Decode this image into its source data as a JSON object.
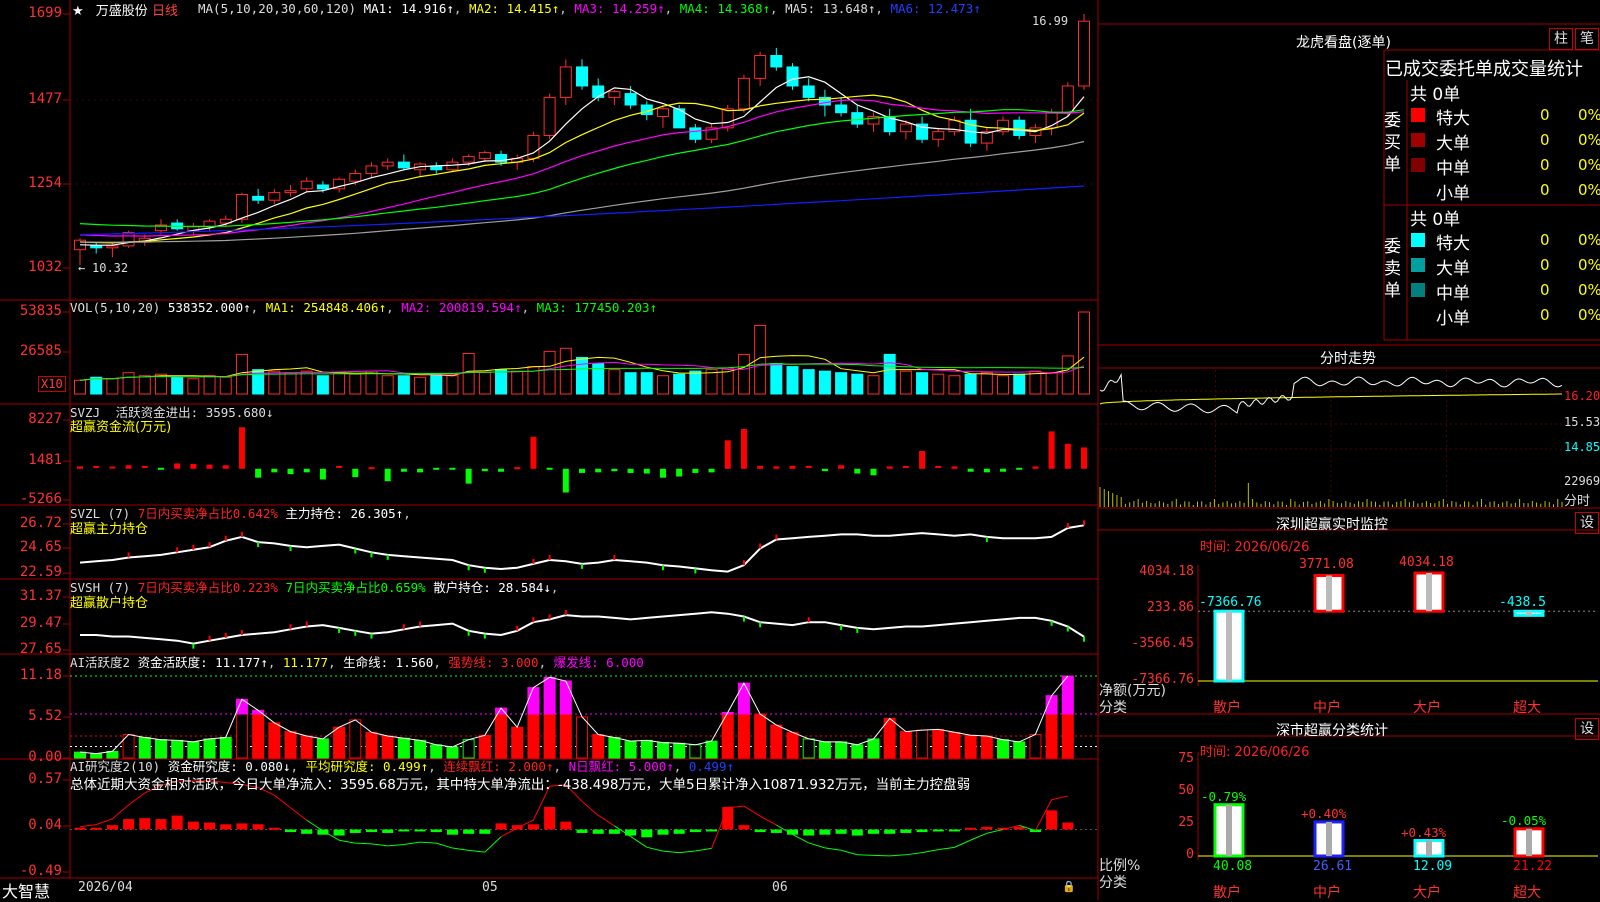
{
  "app": {
    "name": "大智慧",
    "stock": "万盛股份",
    "period": "日线"
  },
  "colors": {
    "up": "#ff2a2a",
    "down": "#00ffff",
    "ma1": "#ffffff",
    "ma2": "#ffff00",
    "ma3": "#ff00ff",
    "ma4": "#00ff00",
    "ma5": "#a0a0a0",
    "ma6": "#1020ff",
    "grid": "#a00000",
    "magenta": "#ff00ff",
    "green": "#00ff00",
    "red": "#ff0000",
    "cyan": "#00ffff",
    "yellow": "#ffff00"
  },
  "header_main": {
    "ma_label": "MA(5,10,20,30,60,120)",
    "ma1": "MA1: 14.916↑",
    "ma2": "MA2: 14.415↑",
    "ma3": "MA3: 14.259↑",
    "ma4": "MA4: 14.368↑",
    "ma5": "MA5: 13.648↑",
    "ma6": "MA6: 12.473↑",
    "high_mark": "16.99",
    "low_mark": "10.32"
  },
  "header_vol": {
    "label": "VOL(5,10,20)",
    "value": "538352.000↑",
    "ma1": "MA1: 254848.406↑",
    "ma2": "MA2: 200819.594↑",
    "ma3": "MA3: 177450.203↑",
    "unit": "X10"
  },
  "header_svzj": {
    "code": "SVZJ",
    "text": "活跃资金进出: 3595.680↓",
    "line2": "超赢资金流(万元)"
  },
  "header_svzl": {
    "code": "SVZL (7)",
    "ratio": "7日内买卖净占比0.642%",
    "hold": "主力持仓: 26.305↑",
    "line2": "超赢主力持仓"
  },
  "header_svsh": {
    "code": "SVSH (7)",
    "ratio1": "7日内买卖净占比0.223%",
    "ratio2": "7日内买卖净占比0.659%",
    "hold": "散户持仓: 28.584↓",
    "line2": "超赢散户持仓"
  },
  "header_ai": {
    "code": "AI活跃度2",
    "a": "资金活跃度: 11.177↑",
    "b": "11.177",
    "c": "生命线: 1.560",
    "d": "强势线: 3.000",
    "e": "爆发线: 6.000"
  },
  "header_ai2": {
    "code": "AI研究度2(10)",
    "a": "资金研究度: 0.080↓",
    "b": "平均研究度: 0.499↑",
    "c": "连续飘红: 2.000↑",
    "d": "N日飘红: 5.000↑",
    "e": "0.499↑",
    "summary": "总体近期大资金相对活跃，今日大单净流入：3595.68万元，其中特大单净流出：-438.498万元，大单5日累计净入10871.932万元，当前主力控盘弱"
  },
  "axes": {
    "main": [
      "1699",
      "1477",
      "1254",
      "1032"
    ],
    "vol": [
      "53835",
      "26585"
    ],
    "svzj": [
      "8227",
      "1481",
      "-5266"
    ],
    "svzl": [
      "26.72",
      "24.65",
      "22.59"
    ],
    "svsh": [
      "31.37",
      "29.47",
      "27.65"
    ],
    "ai": [
      "11.18",
      "5.52",
      "0.00"
    ],
    "ai2": [
      "0.57",
      "0.04",
      "-0.49"
    ]
  },
  "xaxis": {
    "d1": "2026/04",
    "d2": "05",
    "d3": "06"
  },
  "right": {
    "lhb_title": "龙虎看盘(逐单)",
    "btn_zhu": "柱",
    "btn_bi": "笔",
    "order_title": "已成交委托单成交量统计",
    "buy_label": "委买单",
    "sell_label": "委卖单",
    "buy_total": "共 0单",
    "sell_total": "共 0单",
    "rows": [
      {
        "name": "特大",
        "n": "0",
        "p": "0%"
      },
      {
        "name": "大单",
        "n": "0",
        "p": "0%"
      },
      {
        "name": "中单",
        "n": "0",
        "p": "0%"
      },
      {
        "name": "小单",
        "n": "0",
        "p": "0%"
      }
    ],
    "fenshi_title": "分时走势",
    "fenshi_axis": [
      "16.20",
      "15.53",
      "14.85",
      "22969",
      "分时"
    ],
    "monitor_title": "深圳超赢实时监控",
    "monitor_btn": "设",
    "monitor_time": "时间: 2026/06/26",
    "monitor_axis": [
      "4034.18",
      "233.86",
      "-3566.45",
      "-7366.76"
    ],
    "monitor_bars": [
      {
        "cat": "散户",
        "v": -7366.76,
        "label": "-7366.76"
      },
      {
        "cat": "中户",
        "v": 3771.08,
        "label": "3771.08"
      },
      {
        "cat": "大户",
        "v": 4034.18,
        "label": "4034.18"
      },
      {
        "cat": "超大",
        "v": -438.5,
        "label": "-438.5"
      }
    ],
    "monitor_ylab1": "净额(万元)",
    "monitor_ylab2": "分类",
    "class_title": "深市超赢分类统计",
    "class_btn": "设",
    "class_time": "时间: 2026/06/26",
    "class_axis": [
      "75",
      "50",
      "25",
      "0"
    ],
    "class_bars": [
      {
        "cat": "散户",
        "v": 40.08,
        "label": "40.08",
        "chg": "-0.79%"
      },
      {
        "cat": "中户",
        "v": 26.61,
        "label": "26.61",
        "chg": "+0.40%"
      },
      {
        "cat": "大户",
        "v": 12.09,
        "label": "12.09",
        "chg": "+0.43%"
      },
      {
        "cat": "超大",
        "v": 21.22,
        "label": "21.22",
        "chg": "-0.05%"
      }
    ],
    "class_ylab1": "比例%",
    "class_ylab2": "分类"
  },
  "chart_data": [
    {
      "type": "candlestick",
      "title": "万盛股份 日线",
      "ylim": [
        10.32,
        16.99
      ],
      "high": 16.99,
      "low": 10.32,
      "candles": [
        [
          10.8,
          11.1,
          10.4,
          11.05
        ],
        [
          10.9,
          11.0,
          10.7,
          10.85
        ],
        [
          10.85,
          11.0,
          10.6,
          10.9
        ],
        [
          10.9,
          11.3,
          10.85,
          11.25
        ],
        [
          11.0,
          11.2,
          10.9,
          11.1
        ],
        [
          11.3,
          11.6,
          11.2,
          11.45
        ],
        [
          11.5,
          11.6,
          11.3,
          11.35
        ],
        [
          11.3,
          11.5,
          11.2,
          11.4
        ],
        [
          11.4,
          11.6,
          11.3,
          11.55
        ],
        [
          11.5,
          11.7,
          11.4,
          11.6
        ],
        [
          11.6,
          12.3,
          11.5,
          12.25
        ],
        [
          12.2,
          12.4,
          12.0,
          12.1
        ],
        [
          12.1,
          12.4,
          12.0,
          12.3
        ],
        [
          12.3,
          12.5,
          12.2,
          12.35
        ],
        [
          12.4,
          12.7,
          12.3,
          12.6
        ],
        [
          12.5,
          12.6,
          12.3,
          12.4
        ],
        [
          12.4,
          12.7,
          12.3,
          12.65
        ],
        [
          12.6,
          12.9,
          12.5,
          12.8
        ],
        [
          12.8,
          13.1,
          12.7,
          13.0
        ],
        [
          13.0,
          13.2,
          12.9,
          13.1
        ],
        [
          13.1,
          13.3,
          12.9,
          12.95
        ],
        [
          12.9,
          13.1,
          12.7,
          13.05
        ],
        [
          13.0,
          13.1,
          12.8,
          12.9
        ],
        [
          12.9,
          13.2,
          12.85,
          13.1
        ],
        [
          13.1,
          13.3,
          13.0,
          13.25
        ],
        [
          13.2,
          13.4,
          13.1,
          13.35
        ],
        [
          13.3,
          13.4,
          13.0,
          13.1
        ],
        [
          13.1,
          13.3,
          12.9,
          13.2
        ],
        [
          13.2,
          13.9,
          13.1,
          13.8
        ],
        [
          13.8,
          14.9,
          13.7,
          14.8
        ],
        [
          14.8,
          15.8,
          14.6,
          15.6
        ],
        [
          15.6,
          15.8,
          15.0,
          15.1
        ],
        [
          15.1,
          15.3,
          14.7,
          14.8
        ],
        [
          14.8,
          15.0,
          14.6,
          14.95
        ],
        [
          14.9,
          15.1,
          14.5,
          14.6
        ],
        [
          14.6,
          14.7,
          14.2,
          14.35
        ],
        [
          14.3,
          14.6,
          14.0,
          14.5
        ],
        [
          14.5,
          14.6,
          14.0,
          14.0
        ],
        [
          14.0,
          14.1,
          13.6,
          13.7
        ],
        [
          13.7,
          14.1,
          13.6,
          14.0
        ],
        [
          14.0,
          14.6,
          13.9,
          14.5
        ],
        [
          14.5,
          15.4,
          14.4,
          15.3
        ],
        [
          15.3,
          16.0,
          15.1,
          15.9
        ],
        [
          15.9,
          16.1,
          15.5,
          15.6
        ],
        [
          15.6,
          15.7,
          15.0,
          15.1
        ],
        [
          15.1,
          15.3,
          14.7,
          14.8
        ],
        [
          14.8,
          15.0,
          14.3,
          14.6
        ],
        [
          14.6,
          14.8,
          14.3,
          14.4
        ],
        [
          14.4,
          14.6,
          14.0,
          14.1
        ],
        [
          14.1,
          14.4,
          13.9,
          14.3
        ],
        [
          14.3,
          14.5,
          13.8,
          13.9
        ],
        [
          13.9,
          14.2,
          13.7,
          14.1
        ],
        [
          14.1,
          14.3,
          13.6,
          13.7
        ],
        [
          13.7,
          14.0,
          13.5,
          13.9
        ],
        [
          13.9,
          14.3,
          13.8,
          14.2
        ],
        [
          14.2,
          14.5,
          13.5,
          13.6
        ],
        [
          13.6,
          14.0,
          13.4,
          13.9
        ],
        [
          13.9,
          14.3,
          13.8,
          14.2
        ],
        [
          14.2,
          14.3,
          13.7,
          13.8
        ],
        [
          13.8,
          14.1,
          13.6,
          14.0
        ],
        [
          14.0,
          14.5,
          13.8,
          14.4
        ],
        [
          14.4,
          15.2,
          14.3,
          15.1
        ],
        [
          15.1,
          16.99,
          15.0,
          16.8
        ]
      ],
      "ma_last": {
        "MA1": 14.916,
        "MA2": 14.415,
        "MA3": 14.259,
        "MA4": 14.368,
        "MA5": 13.648,
        "MA6": 12.473
      }
    },
    {
      "type": "bar",
      "title": "VOL(5,10,20)",
      "ylim": [
        0,
        53835
      ],
      "unit": "X10",
      "values": [
        9000,
        11000,
        10000,
        14000,
        12000,
        13000,
        11000,
        10000,
        12000,
        11000,
        26000,
        16000,
        15000,
        14000,
        15000,
        12000,
        14000,
        13000,
        15000,
        12000,
        12000,
        11000,
        13000,
        12000,
        26585,
        14000,
        16000,
        15000,
        18000,
        28000,
        30000,
        24000,
        20000,
        16000,
        14000,
        14000,
        12000,
        13000,
        15000,
        16000,
        17000,
        26000,
        45000,
        20000,
        18000,
        16000,
        15000,
        14000,
        13000,
        12000,
        26000,
        15000,
        14000,
        13000,
        12000,
        13000,
        14000,
        12000,
        13000,
        15000,
        14000,
        25000,
        53835
      ],
      "last": 538352.0
    },
    {
      "type": "bar",
      "title": "活跃资金进出 (万元)",
      "ylim": [
        -5266,
        8227
      ],
      "values": [
        400,
        300,
        200,
        600,
        300,
        -200,
        900,
        800,
        700,
        600,
        7000,
        -1500,
        -600,
        -900,
        -600,
        -1800,
        300,
        -1400,
        100,
        -2100,
        -500,
        -600,
        -300,
        -200,
        -2500,
        -400,
        -500,
        100,
        5400,
        -300,
        -4000,
        -700,
        -600,
        -400,
        -700,
        -800,
        -1500,
        -1300,
        -700,
        -600,
        4800,
        6700,
        500,
        400,
        500,
        300,
        -400,
        600,
        -800,
        -1100,
        400,
        300,
        3000,
        300,
        400,
        -500,
        -600,
        -500,
        -300,
        400,
        6300,
        4200,
        3595.68
      ]
    },
    {
      "type": "line",
      "title": "主力持仓",
      "ylim": [
        22.59,
        26.72
      ],
      "values": [
        23.4,
        23.5,
        23.6,
        23.8,
        23.9,
        24.0,
        24.2,
        24.4,
        24.6,
        25.1,
        25.4,
        25.0,
        24.9,
        24.7,
        24.6,
        24.7,
        24.8,
        24.5,
        24.2,
        24.0,
        23.9,
        23.8,
        23.7,
        23.6,
        23.2,
        23.0,
        22.9,
        23.0,
        23.3,
        23.6,
        23.5,
        23.3,
        23.4,
        23.6,
        23.5,
        23.4,
        23.2,
        23.1,
        22.95,
        22.8,
        22.7,
        23.2,
        24.5,
        25.2,
        25.3,
        25.4,
        25.5,
        25.6,
        25.6,
        25.5,
        25.5,
        25.6,
        25.7,
        25.6,
        25.5,
        25.6,
        25.4,
        25.3,
        25.3,
        25.3,
        25.4,
        26.1,
        26.305
      ]
    },
    {
      "type": "line",
      "title": "散户持仓",
      "ylim": [
        27.65,
        31.37
      ],
      "values": [
        28.7,
        28.7,
        28.6,
        28.6,
        28.5,
        28.4,
        28.3,
        28.1,
        28.3,
        28.5,
        28.7,
        28.8,
        28.9,
        29.1,
        29.3,
        29.4,
        29.2,
        29.0,
        28.8,
        28.9,
        29.1,
        29.3,
        29.4,
        29.5,
        29.0,
        28.8,
        28.7,
        29.0,
        29.6,
        29.8,
        30.1,
        30.0,
        30.0,
        29.9,
        29.8,
        29.9,
        30.0,
        30.1,
        30.2,
        30.3,
        30.2,
        30.0,
        29.6,
        29.5,
        29.4,
        29.6,
        29.6,
        29.4,
        29.2,
        29.1,
        29.2,
        29.3,
        29.3,
        29.4,
        29.5,
        29.6,
        29.7,
        29.8,
        29.9,
        29.9,
        29.7,
        29.3,
        28.584
      ]
    },
    {
      "type": "bar",
      "title": "资金活跃度",
      "ylim": [
        0,
        11.18
      ],
      "values": [
        0.8,
        0.6,
        0.9,
        3.2,
        2.8,
        2.5,
        2.4,
        2.2,
        2.6,
        2.8,
        8.0,
        6.5,
        4.8,
        3.6,
        3.0,
        2.6,
        4.2,
        5.2,
        3.5,
        3.0,
        2.7,
        2.4,
        1.8,
        1.5,
        2.5,
        3.1,
        6.8,
        4.2,
        9.6,
        11.0,
        10.5,
        5.6,
        3.2,
        2.8,
        2.3,
        2.4,
        2.1,
        2.0,
        1.8,
        2.3,
        6.2,
        10.2,
        6.0,
        4.5,
        3.5,
        2.6,
        2.2,
        2.2,
        1.8,
        2.6,
        5.4,
        3.6,
        3.8,
        3.9,
        3.5,
        3.1,
        3.0,
        2.5,
        2.2,
        3.2,
        8.5,
        11.177
      ],
      "lines": {
        "生命线": 1.56,
        "强势线": 3.0,
        "爆发线": 6.0
      }
    },
    {
      "type": "bar",
      "title": "资金研究度",
      "ylim": [
        -0.49,
        0.57
      ],
      "values": [
        0.02,
        0.02,
        0.05,
        0.12,
        0.13,
        0.12,
        0.16,
        0.09,
        0.08,
        0.06,
        0.07,
        0.06,
        0.02,
        -0.03,
        -0.05,
        -0.06,
        -0.07,
        -0.04,
        -0.03,
        -0.04,
        -0.02,
        -0.01,
        -0.03,
        -0.06,
        -0.05,
        -0.05,
        0.07,
        0.05,
        0.06,
        0.26,
        0.09,
        -0.04,
        -0.05,
        -0.05,
        -0.07,
        -0.09,
        -0.06,
        -0.05,
        -0.03,
        -0.02,
        0.26,
        0.05,
        -0.03,
        -0.04,
        -0.06,
        -0.07,
        -0.06,
        -0.05,
        -0.07,
        -0.05,
        -0.05,
        -0.04,
        -0.03,
        -0.02,
        -0.02,
        0.02,
        0.03,
        0.02,
        0.03,
        -0.03,
        0.22,
        0.08
      ]
    }
  ]
}
